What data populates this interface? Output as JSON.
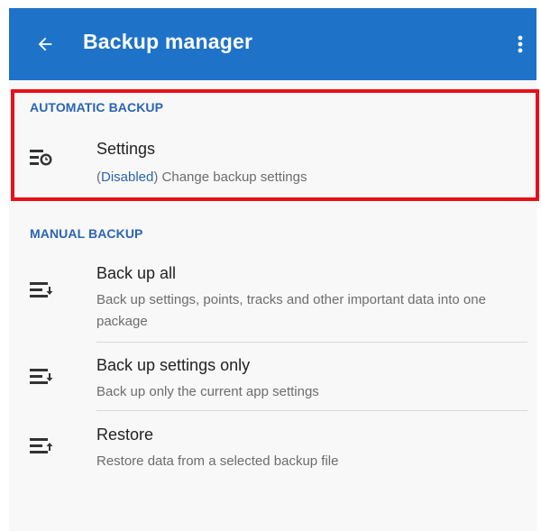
{
  "appbar": {
    "title": "Backup manager",
    "back_icon": "arrow-back-icon",
    "menu_icon": "more-vert-icon",
    "color": "#1e73c8"
  },
  "sections": {
    "automatic": {
      "header": "AUTOMATIC BACKUP",
      "items": [
        {
          "title": "Settings",
          "status": "Disabled",
          "open_paren": "(",
          "close_paren": ")",
          "subtitle": " Change backup settings",
          "icon": "backup-settings-icon"
        }
      ]
    },
    "manual": {
      "header": "MANUAL BACKUP",
      "items": [
        {
          "title": "Back up all",
          "subtitle": "Back up settings, points, tracks and other important data into one package",
          "icon": "backup-all-icon"
        },
        {
          "title": "Back up settings only",
          "subtitle": "Back up only the current app settings",
          "icon": "backup-settings-only-icon"
        },
        {
          "title": "Restore",
          "subtitle": "Restore data from a selected backup file",
          "icon": "restore-icon"
        }
      ]
    }
  },
  "colors": {
    "accent": "#2a64b4",
    "highlight": "#e8101a"
  }
}
